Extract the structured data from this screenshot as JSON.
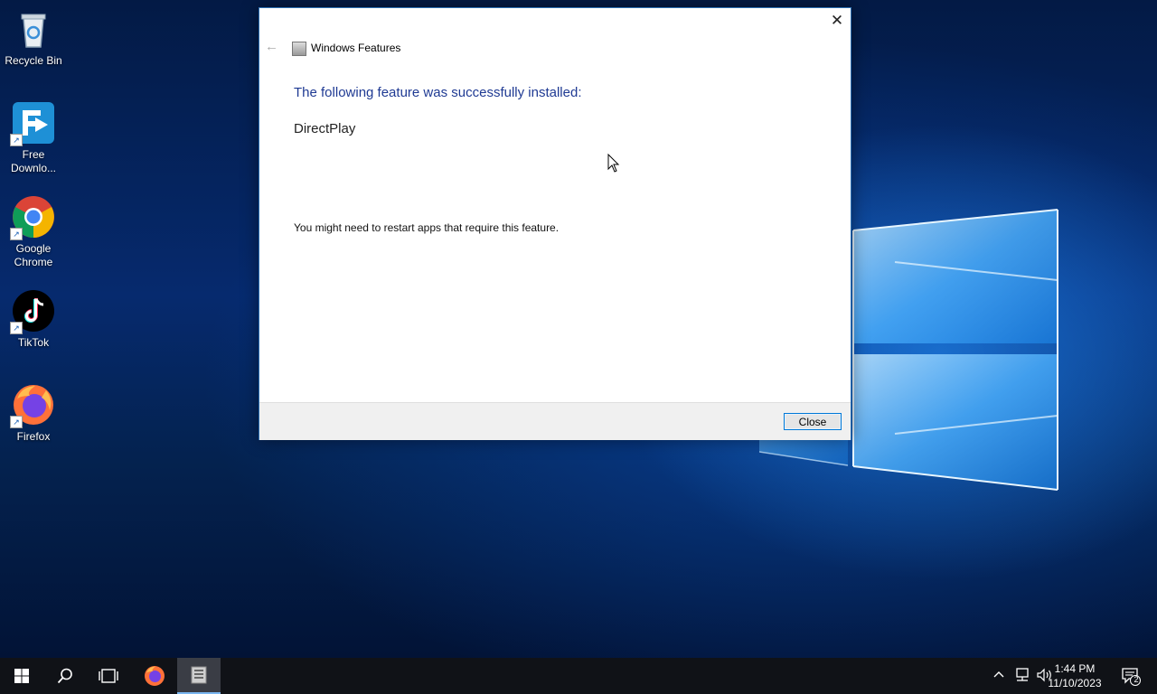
{
  "desktop": {
    "icons": [
      {
        "label": "Recycle Bin"
      },
      {
        "label": "Free Downlo..."
      },
      {
        "label": "Google Chrome"
      },
      {
        "label": "TikTok"
      },
      {
        "label": "Firefox"
      }
    ]
  },
  "dialog": {
    "title": "Windows Features",
    "heading": "The following feature was successfully installed:",
    "feature_name": "DirectPlay",
    "note": "You might need to restart apps that require this feature.",
    "close_button": "Close",
    "close_glyph": "✕",
    "back_glyph": "←"
  },
  "taskbar": {
    "time": "1:44 PM",
    "date": "11/10/2023",
    "notification_count": "2",
    "accent": "#7ab6f0"
  }
}
